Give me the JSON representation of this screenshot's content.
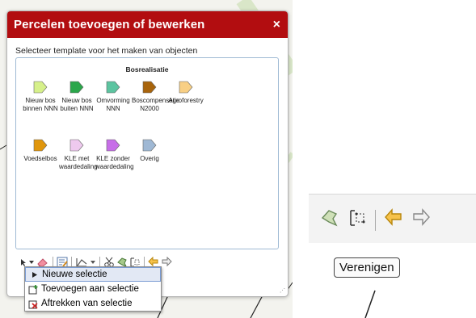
{
  "dialog": {
    "title": "Percelen toevoegen of bewerken",
    "close_symbol": "×",
    "instruction": "Selecteer template voor het maken van objecten"
  },
  "templates": {
    "group_title": "Bosrealisatie",
    "items": [
      {
        "label": "Nieuw bos binnen NNN",
        "color": "#d6f08a"
      },
      {
        "label": "Nieuw bos buiten NNN",
        "color": "#2aa64a"
      },
      {
        "label": "Omvorming NNN",
        "color": "#5cc4a0"
      },
      {
        "label": "Boscompensatie N2000",
        "color": "#a8640c"
      },
      {
        "label": "Agroforestry",
        "color": "#f8cf84"
      },
      {
        "label": "Voedselbos",
        "color": "#e0960c"
      },
      {
        "label": "KLE met waardedaling",
        "color": "#eec9ee"
      },
      {
        "label": "KLE zonder waardedaling",
        "color": "#c76ee8"
      },
      {
        "label": "Overig",
        "color": "#9fb8d4"
      }
    ]
  },
  "toolbar": {
    "icons": [
      "select-arrow-icon",
      "dropdown-arrow-icon",
      "eraser-icon",
      "edit-attributes-icon",
      "line-tool-icon",
      "dropdown-arrow-icon",
      "cut-icon",
      "reshape-icon",
      "merge-icon",
      "undo-icon",
      "redo-icon"
    ]
  },
  "menu": {
    "items": [
      {
        "label": "Nieuwe selectie",
        "icon": "arrow-icon",
        "active": true
      },
      {
        "label": "Toevoegen aan selectie",
        "icon": "add-selection-icon",
        "active": false
      },
      {
        "label": "Aftrekken van selectie",
        "icon": "subtract-selection-icon",
        "active": false
      }
    ]
  },
  "zoom": {
    "tooltip": "Verenigen"
  },
  "colors": {
    "header": "#b20d10",
    "border": "#9fbad4"
  }
}
